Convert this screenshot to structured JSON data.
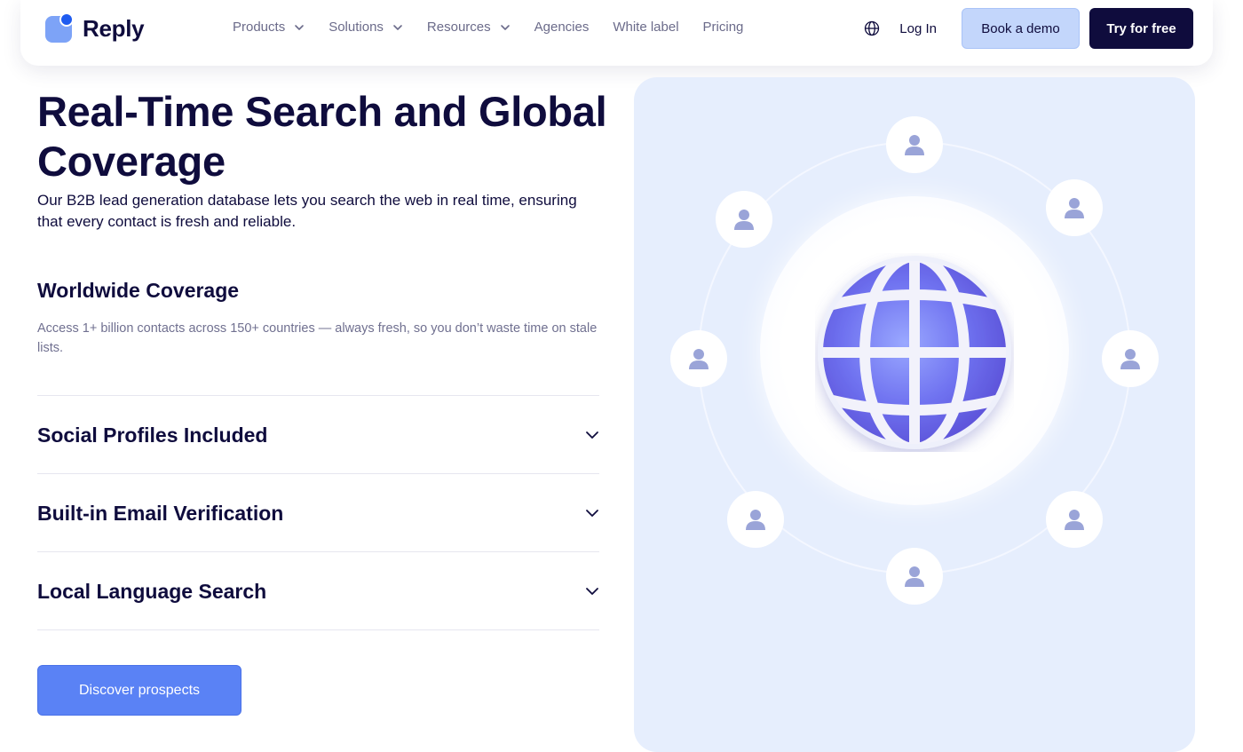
{
  "brand": {
    "name": "Reply"
  },
  "nav": {
    "items": [
      {
        "label": "Products",
        "has_dropdown": true
      },
      {
        "label": "Solutions",
        "has_dropdown": true
      },
      {
        "label": "Resources",
        "has_dropdown": true
      },
      {
        "label": "Agencies",
        "has_dropdown": false
      },
      {
        "label": "White label",
        "has_dropdown": false
      },
      {
        "label": "Pricing",
        "has_dropdown": false
      }
    ],
    "login": "Log In",
    "book_demo": "Book a demo",
    "try_free": "Try for free"
  },
  "hero": {
    "title": "Real-Time Search and Global Coverage",
    "subtitle": "Our B2B lead generation database lets you search the web in real time, ensuring that every contact is fresh and reliable."
  },
  "features": {
    "open": {
      "title": "Worldwide Coverage",
      "description": "Access 1+ billion contacts across 150+ countries — always fresh, so you don’t waste time on stale lists."
    },
    "collapsed": [
      {
        "title": "Social Profiles Included"
      },
      {
        "title": "Built-in Email Verification"
      },
      {
        "title": "Local Language Search"
      }
    ]
  },
  "cta": {
    "label": "Discover prospects"
  },
  "colors": {
    "brand_dark": "#0f0c3d",
    "accent_blue": "#5a82f5",
    "demo_bg": "#c3d6fb",
    "panel_bg": "#e6eefd",
    "avatar_fill": "#9aa4d8"
  },
  "icons": {
    "logo": "reply-logo-icon",
    "dropdown": "chevron-down-icon",
    "language": "globe-icon",
    "accordion": "chevron-down-icon",
    "contact": "person-icon"
  }
}
